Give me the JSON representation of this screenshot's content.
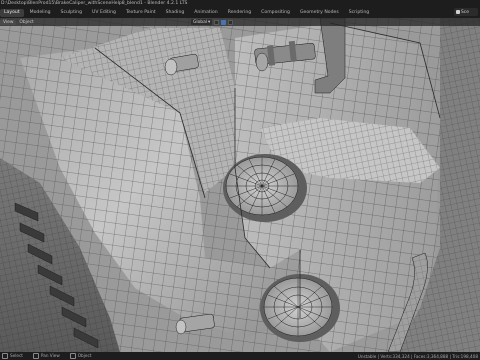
{
  "window": {
    "title": "D:\\Desktop\\BlenProd15\\BrakeCaliper_withSceneHelp8_blend1 - Blender 4.2.1 LTS"
  },
  "workspace_tabs": [
    {
      "label": "Layout",
      "active": true
    },
    {
      "label": "Modeling",
      "active": false
    },
    {
      "label": "Sculpting",
      "active": false
    },
    {
      "label": "UV Editing",
      "active": false
    },
    {
      "label": "Texture Paint",
      "active": false
    },
    {
      "label": "Shading",
      "active": false
    },
    {
      "label": "Animation",
      "active": false
    },
    {
      "label": "Rendering",
      "active": false
    },
    {
      "label": "Compositing",
      "active": false
    },
    {
      "label": "Geometry Nodes",
      "active": false
    },
    {
      "label": "Scripting",
      "active": false
    }
  ],
  "scene_selector": {
    "value": "Sce"
  },
  "viewport_header": {
    "menu": [
      "View",
      "Object"
    ],
    "transform_orientation": "Global"
  },
  "statusbar": {
    "left": [
      "Select",
      "Pan View",
      "Object"
    ],
    "right": "Unstable | Verts:334,324 | Faces:3,364,888 | Tris:198,408"
  },
  "colors": {
    "wire": "#161616",
    "surface_light": "#c9c9c9",
    "surface_dark": "#6e6e6e",
    "accent": "#4772b3"
  }
}
